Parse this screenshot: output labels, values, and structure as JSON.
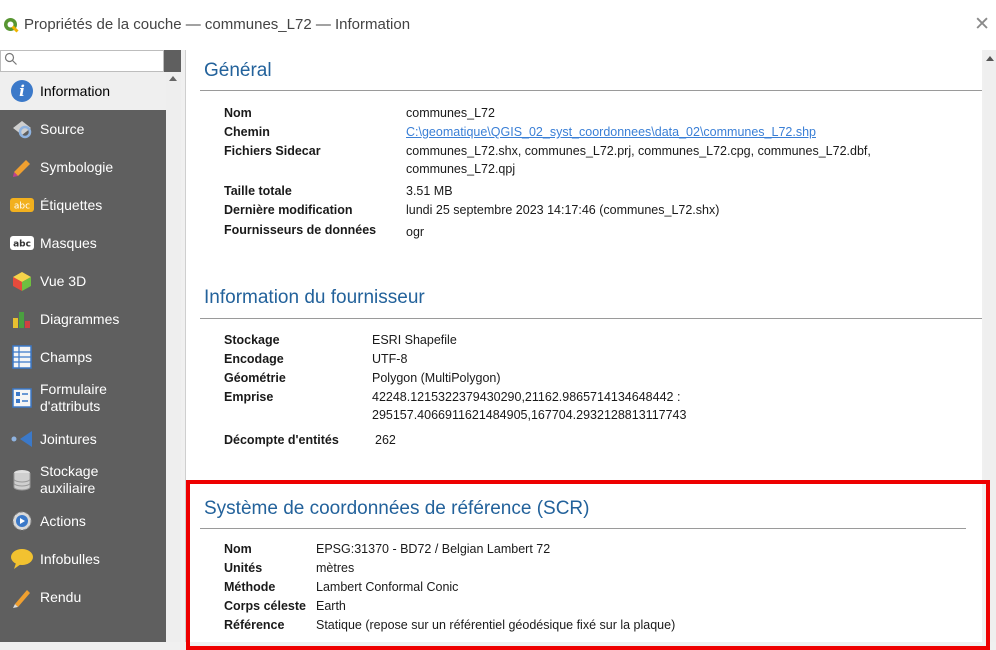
{
  "window": {
    "title": "Propriétés de la couche — communes_L72 — Information",
    "close_glyph": "✕"
  },
  "sidebar": {
    "search_placeholder": "",
    "items": [
      {
        "label": "Information",
        "icon": "info-icon"
      },
      {
        "label": "Source",
        "icon": "source-icon"
      },
      {
        "label": "Symbologie",
        "icon": "symbology-icon"
      },
      {
        "label": "Étiquettes",
        "icon": "labels-icon"
      },
      {
        "label": "Masques",
        "icon": "masks-icon"
      },
      {
        "label": "Vue 3D",
        "icon": "3d-view-icon"
      },
      {
        "label": "Diagrammes",
        "icon": "diagrams-icon"
      },
      {
        "label": "Champs",
        "icon": "fields-icon"
      },
      {
        "label": "Formulaire\nd'attributs",
        "icon": "attributes-form-icon"
      },
      {
        "label": "Jointures",
        "icon": "joins-icon"
      },
      {
        "label": "Stockage\nauxiliaire",
        "icon": "auxiliary-storage-icon"
      },
      {
        "label": "Actions",
        "icon": "actions-icon"
      },
      {
        "label": "Infobulles",
        "icon": "tooltips-icon"
      },
      {
        "label": "Rendu",
        "icon": "rendering-icon"
      }
    ],
    "icon_labels": {
      "abc": "abc"
    }
  },
  "general": {
    "title": "Général",
    "rows": [
      {
        "key": "Nom",
        "value": "communes_L72"
      },
      {
        "key": "Chemin",
        "value": "C:\\geomatique\\QGIS_02_syst_coordonnees\\data_02\\communes_L72.shp"
      },
      {
        "key": "Fichiers Sidecar",
        "value": "communes_L72.shx, communes_L72.prj, communes_L72.cpg, communes_L72.dbf,",
        "value2": "communes_L72.qpj"
      },
      {
        "key": "Taille totale",
        "value": "3.51 MB"
      },
      {
        "key": "Dernière modification",
        "value": "lundi 25 septembre 2023 14:17:46 (communes_L72.shx)"
      },
      {
        "key": "Fournisseurs de données",
        "value": "ogr"
      }
    ]
  },
  "provider": {
    "title": "Information du fournisseur",
    "rows": [
      {
        "key": "Stockage",
        "value": "ESRI Shapefile"
      },
      {
        "key": "Encodage",
        "value": "UTF-8"
      },
      {
        "key": "Géométrie",
        "value": "Polygon (MultiPolygon)"
      },
      {
        "key": "Emprise",
        "value": "42248.1215322379430290,21162.9865714134648442 :",
        "value2": "295157.4066911621484905,167704.2932128813117743"
      },
      {
        "key": "Décompte d'entités",
        "value": "262"
      }
    ]
  },
  "crs": {
    "title": "Système de coordonnées de référence (SCR)",
    "rows": [
      {
        "key": "Nom",
        "value": "EPSG:31370 - BD72 / Belgian Lambert 72"
      },
      {
        "key": "Unités",
        "value": "mètres"
      },
      {
        "key": "Méthode",
        "value": "Lambert Conformal Conic"
      },
      {
        "key": "Corps céleste",
        "value": "Earth"
      },
      {
        "key": "Référence",
        "value": "Statique (repose sur un référentiel géodésique fixé sur la plaque)"
      }
    ]
  },
  "colors": {
    "section_title": "#23629b",
    "link": "#3a7fd6",
    "highlight_box": "#ee0000",
    "sidebar_bg": "#5f5f5f"
  }
}
